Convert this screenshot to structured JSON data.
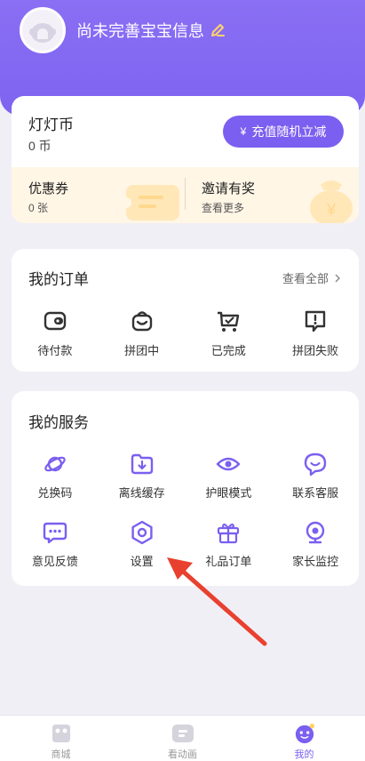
{
  "profile": {
    "name": "尚未完善宝宝信息"
  },
  "coins": {
    "title": "灯灯币",
    "value": "0 币",
    "recharge_label": "充值随机立减",
    "yen_symbol": "¥"
  },
  "coupon": {
    "title": "优惠券",
    "value": "0 张"
  },
  "invite": {
    "title": "邀请有奖",
    "subtitle": "查看更多"
  },
  "orders": {
    "title": "我的订单",
    "view_all": "查看全部",
    "items": [
      {
        "label": "待付款",
        "icon": "wallet-icon"
      },
      {
        "label": "拼团中",
        "icon": "group-bag-icon"
      },
      {
        "label": "已完成",
        "icon": "completed-cart-icon"
      },
      {
        "label": "拼团失败",
        "icon": "failed-alert-icon"
      }
    ]
  },
  "services": {
    "title": "我的服务",
    "items": [
      {
        "label": "兑换码",
        "icon": "planet-icon"
      },
      {
        "label": "离线缓存",
        "icon": "download-folder-icon"
      },
      {
        "label": "护眼模式",
        "icon": "eye-icon"
      },
      {
        "label": "联系客服",
        "icon": "support-chat-icon"
      },
      {
        "label": "意见反馈",
        "icon": "feedback-bubble-icon"
      },
      {
        "label": "设置",
        "icon": "settings-icon"
      },
      {
        "label": "礼品订单",
        "icon": "gift-icon"
      },
      {
        "label": "家长监控",
        "icon": "camera-monitor-icon"
      }
    ]
  },
  "tabbar": {
    "items": [
      {
        "label": "商城",
        "icon": "shop-icon",
        "active": false
      },
      {
        "label": "看动画",
        "icon": "tv-icon",
        "active": false
      },
      {
        "label": "我的",
        "icon": "me-icon",
        "active": true
      }
    ]
  },
  "colors": {
    "accent": "#7b5ff0",
    "header": "#8a6ff4",
    "coupon_bg": "#fff6e6",
    "annotation_arrow": "#e8412f"
  }
}
